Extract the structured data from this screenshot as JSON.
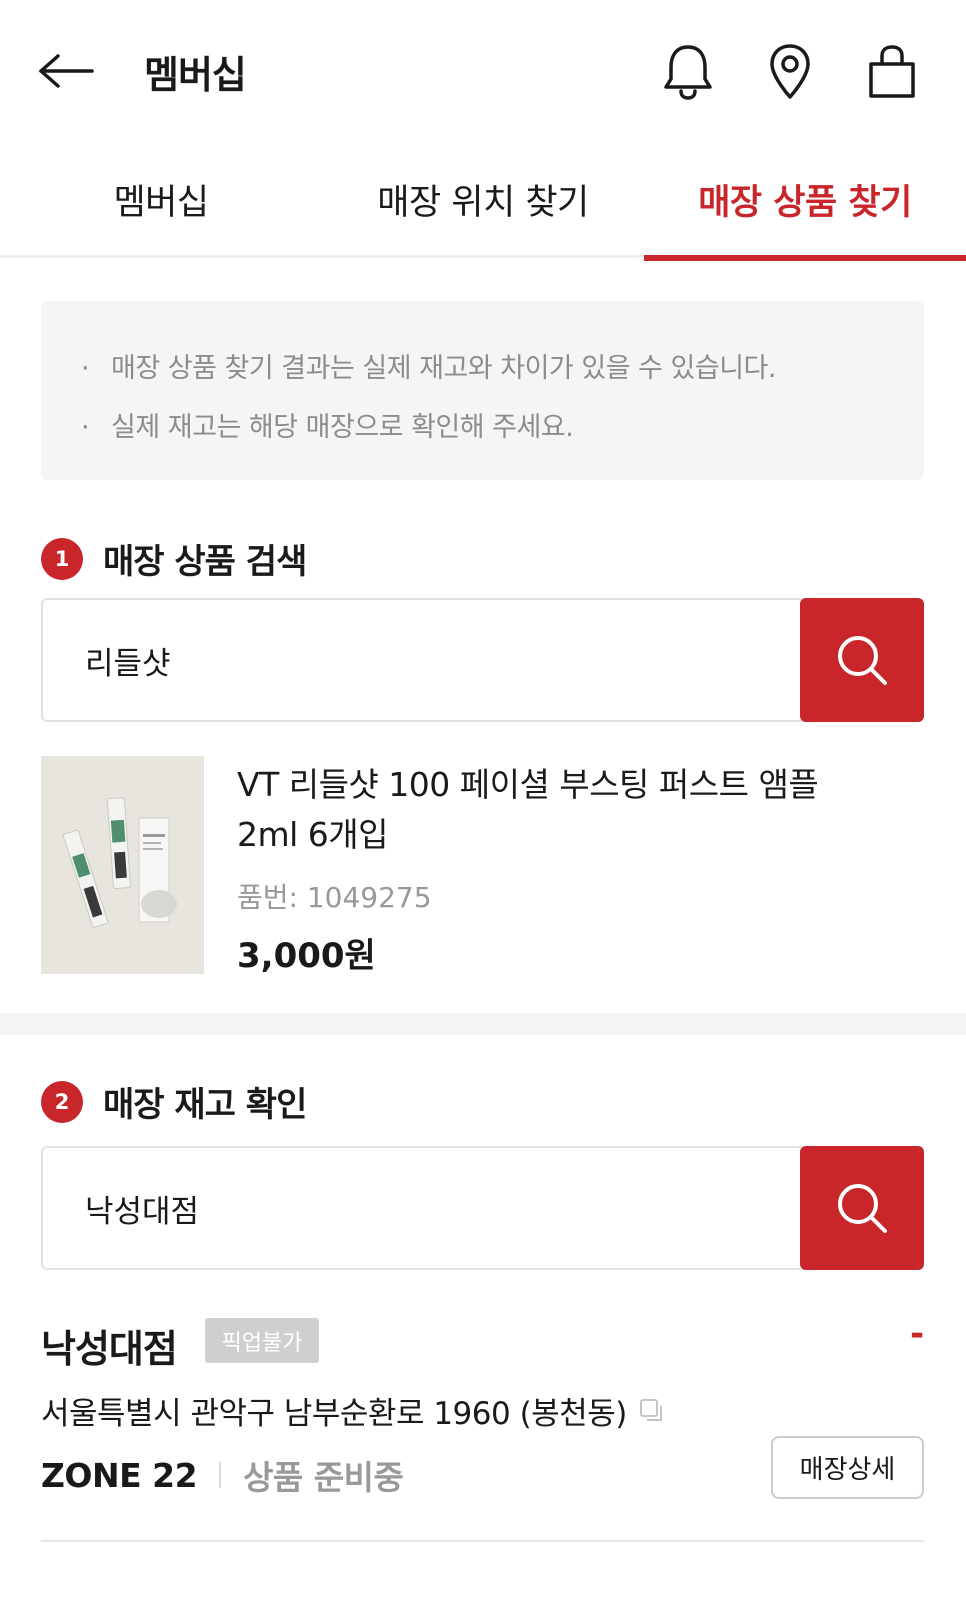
{
  "header": {
    "title": "멤버십",
    "icons": [
      "back-arrow-icon",
      "bell-icon",
      "location-pin-icon",
      "shopping-bag-icon"
    ]
  },
  "tabs": [
    {
      "label": "멤버십",
      "active": false
    },
    {
      "label": "매장 위치 찾기",
      "active": false
    },
    {
      "label": "매장 상품 찾기",
      "active": true
    }
  ],
  "notice": {
    "lines": [
      "매장 상품 찾기 결과는 실제 재고와 차이가 있을 수 있습니다.",
      "실제 재고는 해당 매장으로 확인해 주세요."
    ]
  },
  "product_search": {
    "step": "1",
    "title": "매장 상품 검색",
    "query": "리들샷"
  },
  "product": {
    "name": "VT 리들샷 100 페이셜 부스팅 퍼스트 앰플 2ml 6개입",
    "code": "품번: 1049275",
    "price": "3,000원"
  },
  "stock_check": {
    "step": "2",
    "title": "매장 재고 확인",
    "query": "낙성대점"
  },
  "store": {
    "name": "낙성대점",
    "pickup_badge": "픽업불가",
    "dash": "-",
    "address": "서울특별시 관악구 남부순환로 1960 (봉천동)",
    "zone": "ZONE 22",
    "stock_status": "상품 준비중",
    "detail_button": "매장상세"
  },
  "colors": {
    "accent": "#c8262b",
    "notice_bg": "#f5f5f5",
    "muted_text": "#999999"
  }
}
